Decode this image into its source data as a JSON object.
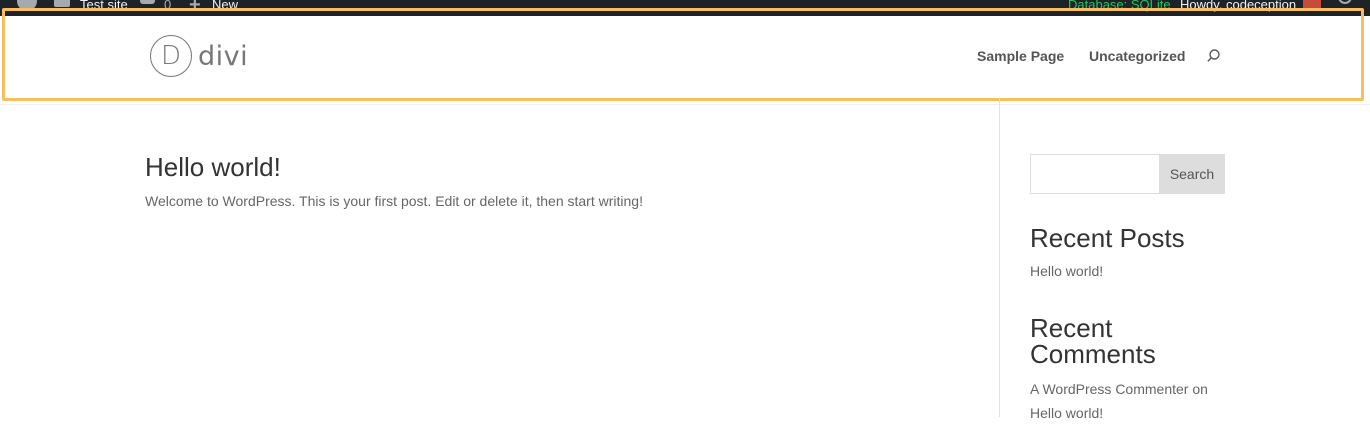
{
  "adminbar": {
    "site_name": "Test site",
    "comments_count": "0",
    "new_label": "New",
    "database": "Database: SQLite",
    "howdy": "Howdy, codeception"
  },
  "header": {
    "logo_letter": "D",
    "logo_text": "divi",
    "nav": [
      "Sample Page",
      "Uncategorized"
    ]
  },
  "post": {
    "title": "Hello world!",
    "excerpt": "Welcome to WordPress. This is your first post. Edit or delete it, then start writing!"
  },
  "sidebar": {
    "search_button": "Search",
    "recent_posts_title": "Recent Posts",
    "recent_posts": [
      "Hello world!"
    ],
    "recent_comments_title": "Recent Comments",
    "recent_comment_author": "A WordPress Commenter",
    "recent_comment_on": "on",
    "recent_comment_post": "Hello world!"
  },
  "colors": {
    "adminbar_bg": "#1d2327",
    "database_text": "#22c55e",
    "highlight_border": "#f6be5f",
    "search_button_bg": "#dddddd"
  }
}
